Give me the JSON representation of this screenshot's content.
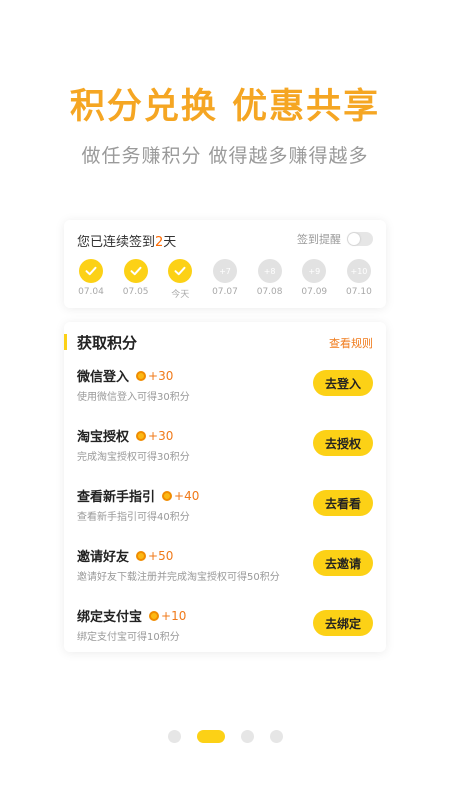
{
  "hero": {
    "title": "积分兑换 优惠共享",
    "subtitle": "做任务赚积分 做得越多赚得越多"
  },
  "signin": {
    "prefix": "您已连续签到",
    "count": "2",
    "suffix": "天",
    "reminder_label": "签到提醒",
    "reminder_on": false,
    "days": [
      {
        "label": "07.04",
        "state": "done",
        "bonus": ""
      },
      {
        "label": "07.05",
        "state": "done",
        "bonus": ""
      },
      {
        "label": "今天",
        "state": "done",
        "bonus": ""
      },
      {
        "label": "07.07",
        "state": "pending",
        "bonus": "+7"
      },
      {
        "label": "07.08",
        "state": "pending",
        "bonus": "+8"
      },
      {
        "label": "07.09",
        "state": "pending",
        "bonus": "+9"
      },
      {
        "label": "07.10",
        "state": "pending",
        "bonus": "+10"
      }
    ]
  },
  "tasks": {
    "title": "获取积分",
    "rules_link": "查看规则",
    "items": [
      {
        "name": "微信登入",
        "points": "+30",
        "desc": "使用微信登入可得30积分",
        "button": "去登入"
      },
      {
        "name": "淘宝授权",
        "points": "+30",
        "desc": "完成淘宝授权可得30积分",
        "button": "去授权"
      },
      {
        "name": "查看新手指引",
        "points": "+40",
        "desc": "查看新手指引可得40积分",
        "button": "去看看"
      },
      {
        "name": "邀请好友",
        "points": "+50",
        "desc": "邀请好友下载注册并完成淘宝授权可得50积分",
        "button": "去邀请"
      },
      {
        "name": "绑定支付宝",
        "points": "+10",
        "desc": "绑定支付宝可得10积分",
        "button": "去绑定"
      }
    ]
  },
  "pager": {
    "count": 4,
    "active_index": 1
  },
  "colors": {
    "accent": "#fcd116",
    "orange": "#f07a1a",
    "title_orange": "#f5a623"
  }
}
